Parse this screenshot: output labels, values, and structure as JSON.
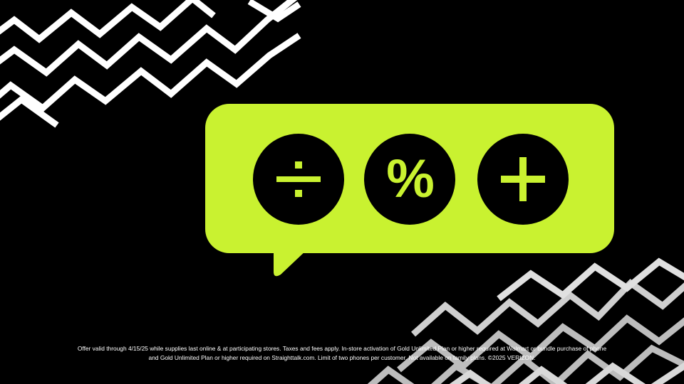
{
  "colors": {
    "background": "#000000",
    "accent_green": "#c9f230",
    "zigzag_white": "#ffffff",
    "zigzag_gray": "#bdbdbd"
  },
  "bubble": {
    "icons": [
      {
        "name": "divide-icon",
        "symbol": "÷"
      },
      {
        "name": "percent-icon",
        "symbol": "%"
      },
      {
        "name": "plus-icon",
        "symbol": "+"
      }
    ]
  },
  "disclaimer": {
    "line1": "Offer valid through 4/15/25 while supplies last online & at participating stores. Taxes and fees apply. In-store activation of Gold Unlimited Plan or higher required at Walmart or bundle purchase of phone",
    "line2": "and Gold Unlimited Plan or higher required on Straighttalk.com. Limit of two phones per customer. Not available on family plans. ©2025 VERIZON."
  }
}
